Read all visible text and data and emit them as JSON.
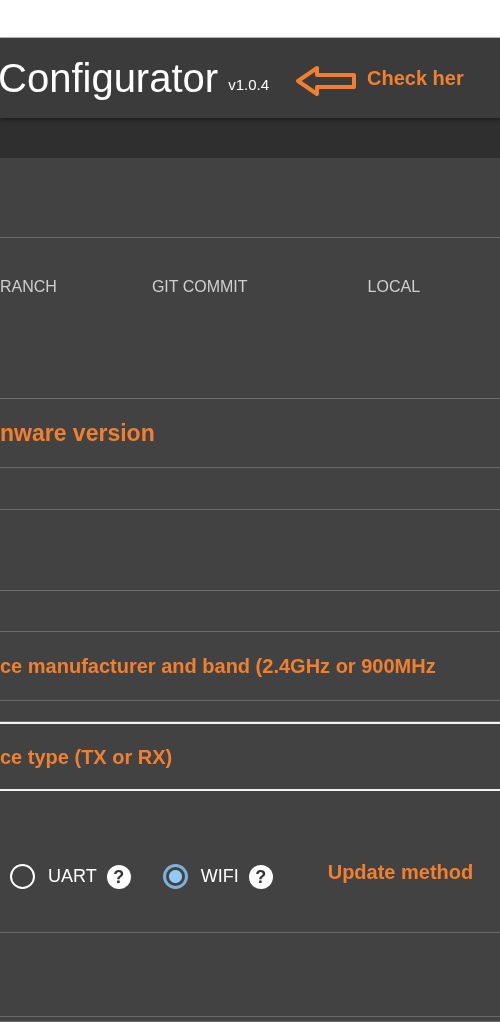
{
  "header": {
    "title": "Configurator",
    "version": "v1.0.4",
    "annotation": "Check her"
  },
  "rows": [
    {
      "kind": "blank",
      "framed": false
    },
    {
      "kind": "columns",
      "framed": false,
      "columns": [
        "RANCH",
        "GIT COMMIT",
        "LOCAL"
      ]
    },
    {
      "kind": "heading",
      "framed": false,
      "text": "nware version"
    },
    {
      "kind": "blank",
      "framed": false
    },
    {
      "kind": "blank",
      "framed": false
    },
    {
      "kind": "blank",
      "framed": false
    },
    {
      "kind": "heading",
      "framed": false,
      "text": "ce manufacturer and band (2.4GHz or 900MHz"
    },
    {
      "kind": "blank",
      "framed": false
    },
    {
      "kind": "heading",
      "framed": true,
      "text": "ce type (TX or RX)"
    },
    {
      "kind": "radios",
      "framed": false,
      "options": [
        {
          "label": "UART",
          "help": "?",
          "selected": false
        },
        {
          "label": "WIFI",
          "help": "?",
          "selected": true
        }
      ],
      "annotation": "Update method"
    },
    {
      "kind": "blank",
      "framed": false
    },
    {
      "kind": "blank",
      "framed": false
    }
  ]
}
